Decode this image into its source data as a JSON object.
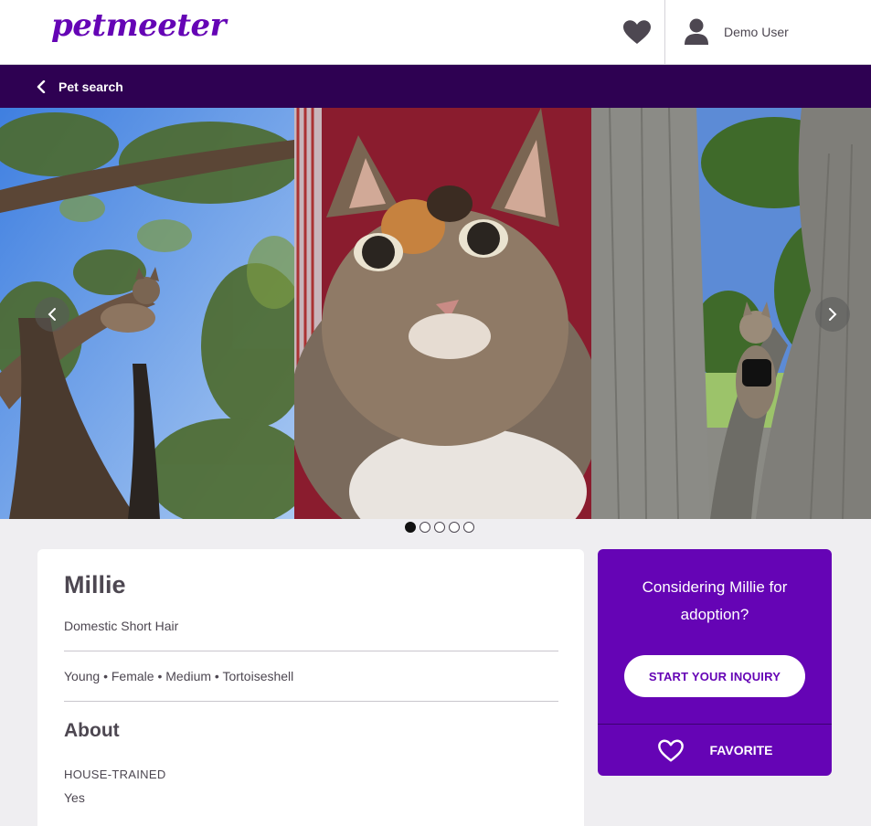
{
  "header": {
    "logo": "petmeeter",
    "user_name": "Demo User"
  },
  "subnav": {
    "back_label": "Pet search"
  },
  "carousel": {
    "dot_count": 5,
    "active_index": 0
  },
  "pet": {
    "name": "Millie",
    "breed": "Domestic Short Hair",
    "attributes": "Young • Female • Medium • Tortoiseshell",
    "about_heading": "About",
    "house_trained_label": "HOUSE-TRAINED",
    "house_trained_value": "Yes"
  },
  "adoption": {
    "prompt": "Considering Millie for adoption?",
    "inquiry_label": "START YOUR INQUIRY",
    "favorite_label": "FAVORITE"
  },
  "colors": {
    "brand": "#6504b5",
    "subnav": "#2e0152"
  }
}
